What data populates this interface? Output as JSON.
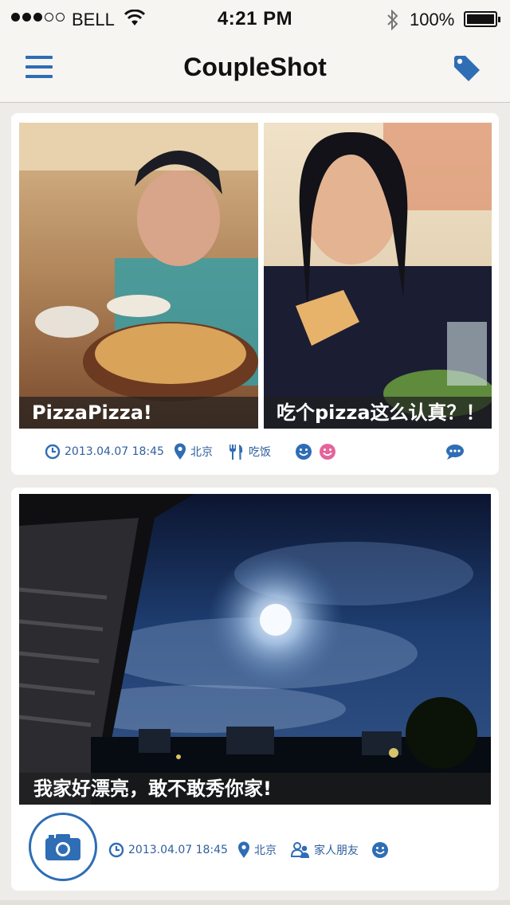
{
  "status_bar": {
    "carrier": "BELL",
    "time": "4:21 PM",
    "battery": "100%",
    "signal_bars_filled": 3,
    "signal_bars_total": 5
  },
  "header": {
    "title": "CoupleShot",
    "menu_icon": "hamburger-menu-icon",
    "tag_icon": "tag-icon"
  },
  "posts": [
    {
      "photos": [
        {
          "caption": "PizzaPizza!"
        },
        {
          "caption": "吃个pizza这么认真？！"
        }
      ],
      "datetime": "2013.04.07 18:45",
      "location": "北京",
      "category": "吃饭",
      "category_icon": "fork-knife-icon",
      "reactions": [
        "smiley-blue",
        "smiley-pink"
      ],
      "comment_icon": "comment-icon"
    },
    {
      "photos": [
        {
          "caption": "我家好漂亮，敢不敢秀你家!"
        }
      ],
      "datetime": "2013.04.07 18:45",
      "location": "北京",
      "category": "家人朋友",
      "category_icon": "people-icon",
      "reactions": [
        "smiley-blue"
      ],
      "camera_icon": "camera-icon"
    }
  ],
  "colors": {
    "accent": "#2f6db5",
    "meta_text": "#2f5f9e",
    "pink": "#e4649b",
    "background": "#eeece8"
  }
}
